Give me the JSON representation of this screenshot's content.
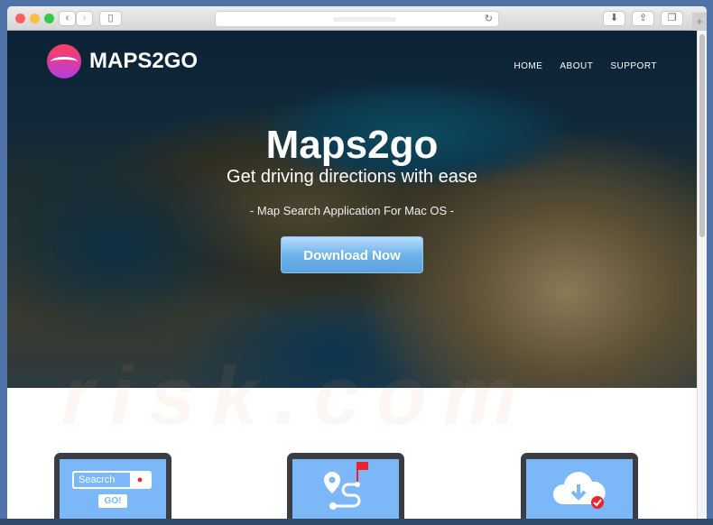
{
  "browser": {
    "back_icon": "chevron-left-icon",
    "forward_icon": "chevron-right-icon",
    "sidebar_icon": "sidebar-icon",
    "reload_icon": "reload-icon",
    "download_icon": "download-icon",
    "share_icon": "share-icon",
    "tabs_icon": "tabs-icon",
    "new_tab": "+"
  },
  "site": {
    "logo": "MAPS2GO",
    "nav": [
      "HOME",
      "ABOUT",
      "SUPPORT"
    ],
    "hero": {
      "title": "Maps2go",
      "subtitle": "Get driving directions with ease",
      "tagline": "- Map Search Application For Mac OS -",
      "cta": "Download Now"
    },
    "features": [
      {
        "icon": "search-box-icon",
        "search_text": "Seacrch",
        "go": "GO!"
      },
      {
        "icon": "route-flag-icon"
      },
      {
        "icon": "cloud-download-icon"
      }
    ]
  },
  "colors": {
    "accent": "#7cb7f7",
    "cta": "#6fb3ec",
    "flag": "#e8242e"
  }
}
